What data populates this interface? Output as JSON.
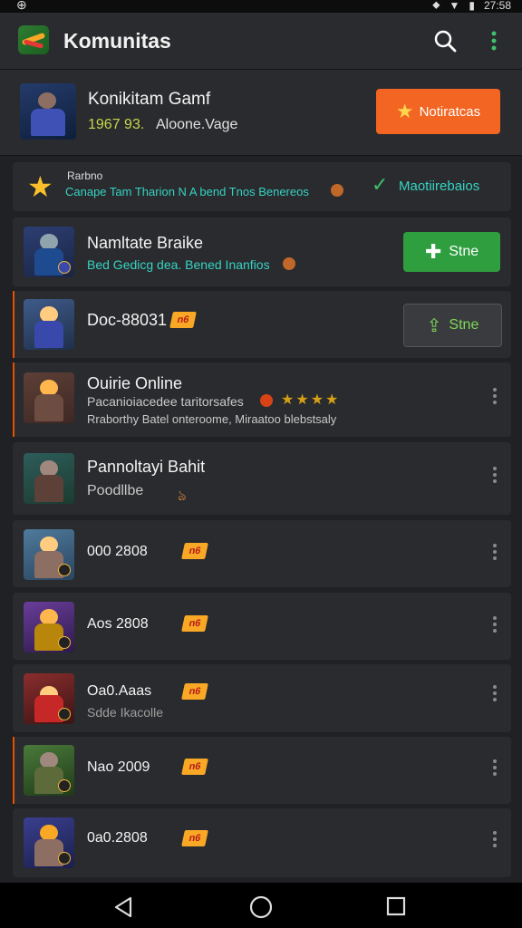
{
  "status": {
    "left_icon": "⊕",
    "time": "27:58"
  },
  "topbar": {
    "title": "Komunitas"
  },
  "header": {
    "title": "Konikitam Gamf",
    "sub_num": "1967 93.",
    "sub_text": "Aloone.Vage",
    "button": "Notiratcas"
  },
  "promo": {
    "label": "Rarbno",
    "text": "Canape Tam Tharion N A bend Tnos Benereos",
    "action": "Maotiirebaios"
  },
  "rows": [
    {
      "title": "Namltate Braike",
      "sub": "Bed Gedicg dea. Bened Inanfios",
      "button": "Stne",
      "button_style": "green"
    },
    {
      "title": "Doc-88031",
      "tag": "n6",
      "button": "Stne",
      "button_style": "gray"
    },
    {
      "title": "Ouirie Online",
      "sub": "Pacanioiacedee taritorsafes",
      "sub2": "Rraborthy Batel onteroome, Miraatoo blebstsaly",
      "rating": "★★★★"
    },
    {
      "title": "Pannoltayi Bahit",
      "sub": "Poodllbe"
    },
    {
      "title": "000 2808",
      "tag": "n6"
    },
    {
      "title": "Aos 2808",
      "tag": "n6"
    },
    {
      "title": "Oa0.Aaas",
      "tag": "n6",
      "sub": "Sdde Ikacolle"
    },
    {
      "title": "Nao 2009",
      "tag": "n6"
    },
    {
      "title": "0a0.2808",
      "tag": "n6"
    }
  ],
  "colors": {
    "accent": "#e65100",
    "green": "#2e9e3e",
    "star": "#f2b63b",
    "teal": "#36d3c4"
  }
}
